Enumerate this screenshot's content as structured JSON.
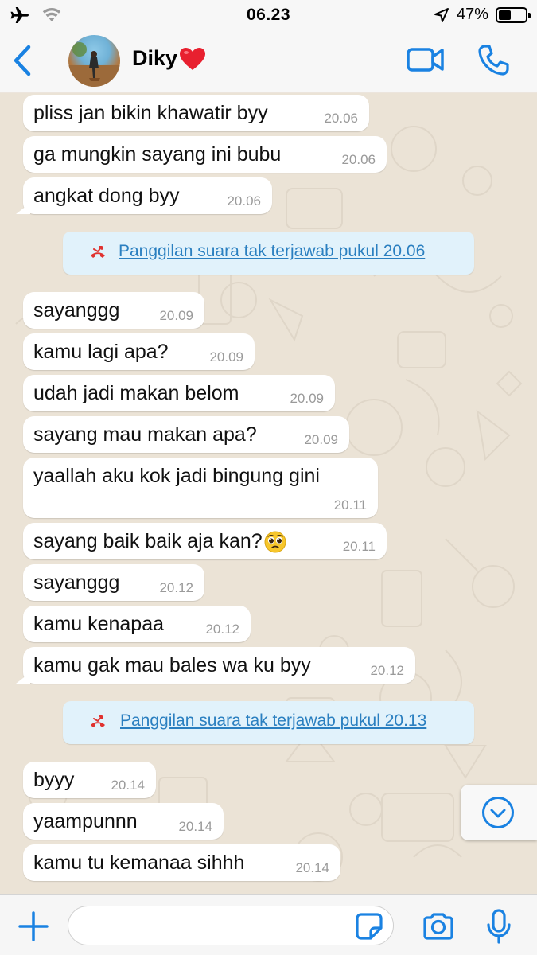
{
  "status_bar": {
    "time": "06.23",
    "battery_text": "47%",
    "battery_level": 0.47,
    "icons": [
      "airplane-icon",
      "wifi-icon",
      "location-arrow-icon",
      "battery-icon"
    ]
  },
  "header": {
    "contact_name": "Diky",
    "name_emoji_icon": "red-heart-icon",
    "icons": [
      "back-chevron-icon",
      "video-call-icon",
      "voice-call-icon"
    ]
  },
  "messages": [
    {
      "text": "pliss jan bikin khawatir byy",
      "time": "20.06"
    },
    {
      "text": "ga mungkin sayang ini bubu",
      "time": "20.06"
    },
    {
      "text": "angkat dong byy",
      "time": "20.06"
    },
    {
      "text": "sayanggg",
      "time": "20.09"
    },
    {
      "text": "kamu lagi apa?",
      "time": "20.09"
    },
    {
      "text": "udah jadi makan belom",
      "time": "20.09"
    },
    {
      "text": "sayang mau makan apa?",
      "time": "20.09"
    },
    {
      "text": "yaallah aku kok jadi bingung gini",
      "time": "20.11"
    },
    {
      "text": "sayang baik baik aja kan?",
      "time": "20.11",
      "emoji_icon": "pleading-face-icon"
    },
    {
      "text": "sayanggg",
      "time": "20.12"
    },
    {
      "text": "kamu kenapaa",
      "time": "20.12"
    },
    {
      "text": "kamu gak mau bales wa ku byy",
      "time": "20.12"
    },
    {
      "text": "byyy",
      "time": "20.14"
    },
    {
      "text": "yaampunnn",
      "time": "20.14"
    },
    {
      "text": "kamu tu kemanaa sihhh",
      "time": "20.14"
    }
  ],
  "system_messages": [
    {
      "text": "Panggilan suara tak terjawab pukul 20.06",
      "icon": "missed-call-icon"
    },
    {
      "text": "Panggilan suara tak terjawab pukul 20.13",
      "icon": "missed-call-icon"
    }
  ],
  "input_bar": {
    "placeholder": "",
    "icons": [
      "plus-icon",
      "sticker-icon",
      "camera-icon",
      "microphone-icon"
    ]
  },
  "scroll_button": {
    "icon": "chevron-down-circle-icon"
  },
  "colors": {
    "accent": "#1a82e2",
    "chat_background": "#ebe3d6",
    "bubble": "#ffffff",
    "system_pill": "#e1f2fb",
    "system_text": "#2a7fc0",
    "missed_call": "#e0322f",
    "timestamp": "#9a9a9a"
  }
}
